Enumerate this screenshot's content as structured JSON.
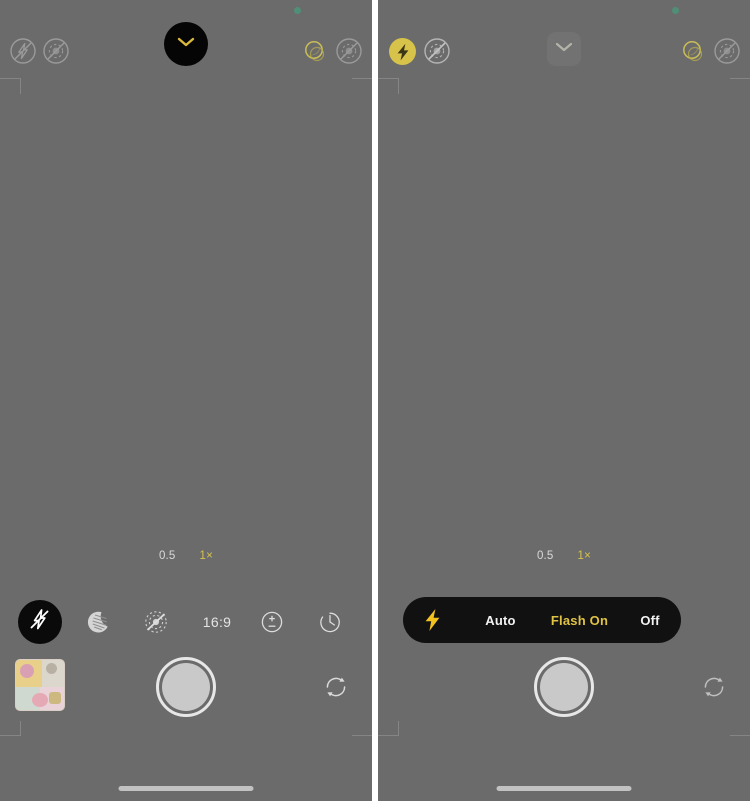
{
  "app": {
    "name": "Camera",
    "platform": "iOS",
    "background_color": "#6b6b6b",
    "accent_yellow": "#d6c44e"
  },
  "panels": [
    {
      "id": "left",
      "name": "flash-off-state",
      "privacy_dot": {
        "name": "camera-in-use-indicator",
        "color": "#4f8f77"
      },
      "topbar": {
        "flash_icon": "flash-off-icon",
        "flash_state_label": "Flash Off",
        "live_photo_icon": "live-photo-off-icon",
        "live_photo_state_label": "Live Photo Off",
        "chevron_icon": "chevron-down-icon",
        "chevron_expanded": true,
        "night_mode_icon": "night-mode-icon",
        "night_mode_state_label": "Night Mode",
        "live_photo_right_icon": "live-photo-off-icon"
      },
      "zoom": {
        "options": [
          {
            "label": "0.5",
            "active": false
          },
          {
            "label": "1×",
            "active": true
          }
        ]
      },
      "controls": [
        {
          "name": "flash-control",
          "icon": "flash-off-icon",
          "label": "",
          "highlighted": true
        },
        {
          "name": "night-mode-control",
          "icon": "night-mode-icon",
          "label": "",
          "highlighted": false
        },
        {
          "name": "live-photo-control",
          "icon": "live-photo-off-icon",
          "label": "",
          "highlighted": false
        },
        {
          "name": "aspect-ratio-control",
          "icon": "",
          "label": "16:9",
          "highlighted": false
        },
        {
          "name": "exposure-control",
          "icon": "exposure-plus-minus-icon",
          "label": "",
          "highlighted": false
        },
        {
          "name": "timer-control",
          "icon": "timer-icon",
          "label": "",
          "highlighted": false
        }
      ],
      "bottombar": {
        "thumbnail_name": "photo-library-thumbnail",
        "shutter_name": "shutter-button",
        "flip_icon": "camera-flip-icon"
      }
    },
    {
      "id": "right",
      "name": "flash-on-state",
      "privacy_dot": {
        "name": "camera-in-use-indicator",
        "color": "#4f8f77"
      },
      "topbar": {
        "flash_icon": "flash-on-icon",
        "flash_state_label": "Flash On",
        "live_photo_icon": "live-photo-off-icon",
        "live_photo_state_label": "Live Photo Off",
        "chevron_icon": "chevron-down-icon",
        "chevron_expanded": true,
        "night_mode_icon": "night-mode-icon",
        "night_mode_state_label": "Night Mode",
        "live_photo_right_icon": "live-photo-off-icon"
      },
      "zoom": {
        "options": [
          {
            "label": "0.5",
            "active": false
          },
          {
            "label": "1×",
            "active": true
          }
        ]
      },
      "flash_menu": {
        "name": "flash-options-menu",
        "bolt_icon": "flash-bolt-icon",
        "options": [
          {
            "label": "Auto",
            "selected": false
          },
          {
            "label": "Flash On",
            "selected": true
          },
          {
            "label": "Off",
            "selected": false
          }
        ]
      },
      "bottombar": {
        "thumbnail_name": "photo-library-thumbnail",
        "shutter_name": "shutter-button",
        "flip_icon": "camera-flip-icon"
      }
    }
  ]
}
